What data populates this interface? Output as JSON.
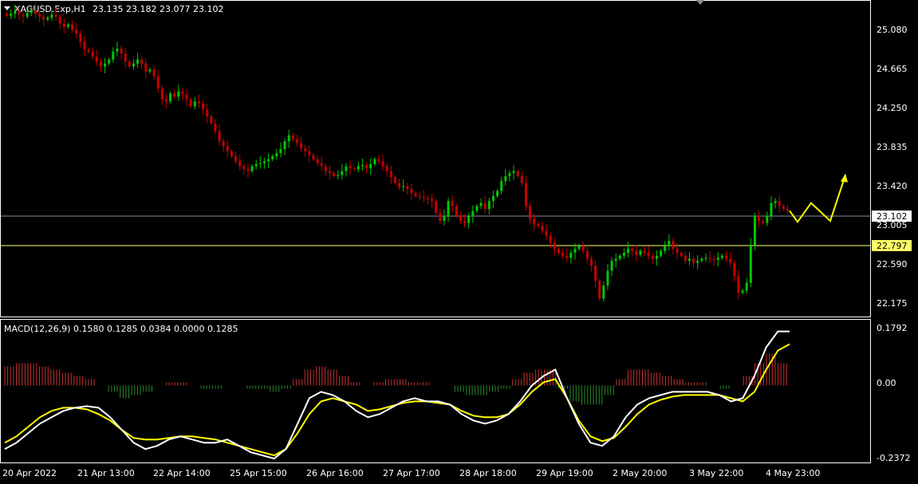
{
  "symbol_header": {
    "symbol": "XAGUSD.Exp,H1",
    "ohlc": "23.135 23.182 23.077 23.102"
  },
  "macd_header": {
    "label": "MACD(12,26,9) 0.1580 0.1285 0.0384 0.0000 0.1285"
  },
  "price_axis": {
    "ticks": [
      "25.080",
      "24.665",
      "24.250",
      "23.835",
      "23.420",
      "23.005",
      "22.590",
      "22.175"
    ],
    "current_price": "23.102",
    "level_line": "22.797"
  },
  "macd_axis": {
    "ticks": [
      "0.1792",
      "0.00",
      "-0.2372"
    ]
  },
  "time_axis": {
    "labels": [
      "20 Apr 2022",
      "21 Apr 13:00",
      "22 Apr 14:00",
      "25 Apr 15:00",
      "26 Apr 16:00",
      "27 Apr 17:00",
      "28 Apr 18:00",
      "29 Apr 19:00",
      "2 May 20:00",
      "3 May 22:00",
      "4 May 23:00"
    ]
  },
  "colors": {
    "background": "#000000",
    "bull_candle": "#00c800",
    "bear_candle": "#c80000",
    "macd_line": "#ffffff",
    "signal_line": "#ffff00",
    "level_line": "#ffff66",
    "current_price_line": "#8a8a9a",
    "axis_text": "#ffffff"
  },
  "chart_data": {
    "type": "candlestick",
    "title": "XAGUSD.Exp,H1",
    "ylim": [
      22.08,
      25.17
    ],
    "macd_ylim": [
      -0.2372,
      0.1792
    ],
    "closes": [
      25.06,
      25.08,
      25.1,
      25.07,
      25.05,
      25.09,
      25.12,
      25.08,
      25.05,
      25.02,
      25.04,
      25.07,
      25.05,
      24.98,
      24.95,
      24.97,
      24.92,
      24.88,
      24.8,
      24.72,
      24.7,
      24.65,
      24.6,
      24.55,
      24.58,
      24.62,
      24.7,
      24.73,
      24.68,
      24.6,
      24.55,
      24.58,
      24.62,
      24.58,
      24.5,
      24.52,
      24.45,
      24.33,
      24.22,
      24.2,
      24.28,
      24.25,
      24.3,
      24.27,
      24.22,
      24.15,
      24.2,
      24.18,
      24.12,
      24.05,
      23.98,
      23.9,
      23.8,
      23.75,
      23.7,
      23.65,
      23.6,
      23.55,
      23.52,
      23.5,
      23.55,
      23.57,
      23.58,
      23.6,
      23.62,
      23.65,
      23.68,
      23.72,
      23.8,
      23.86,
      23.82,
      23.78,
      23.73,
      23.7,
      23.66,
      23.62,
      23.58,
      23.55,
      23.5,
      23.48,
      23.45,
      23.46,
      23.5,
      23.55,
      23.53,
      23.52,
      23.55,
      23.56,
      23.53,
      23.57,
      23.62,
      23.6,
      23.55,
      23.5,
      23.44,
      23.38,
      23.34,
      23.35,
      23.32,
      23.28,
      23.25,
      23.24,
      23.23,
      23.22,
      23.2,
      23.08,
      23.0,
      23.05,
      23.2,
      23.15,
      23.05,
      23.0,
      22.98,
      23.05,
      23.1,
      23.15,
      23.18,
      23.12,
      23.2,
      23.25,
      23.3,
      23.4,
      23.45,
      23.48,
      23.5,
      23.45,
      23.38,
      23.15,
      23.02,
      22.97,
      22.95,
      22.9,
      22.85,
      22.78,
      22.72,
      22.68,
      22.65,
      22.63,
      22.68,
      22.72,
      22.75,
      22.7,
      22.62,
      22.55,
      22.4,
      22.22,
      22.35,
      22.5,
      22.6,
      22.62,
      22.65,
      22.68,
      22.72,
      22.7,
      22.66,
      22.7,
      22.68,
      22.65,
      22.62,
      22.65,
      22.7,
      22.75,
      22.8,
      22.72,
      22.68,
      22.65,
      22.6,
      22.62,
      22.58,
      22.6,
      22.62,
      22.63,
      22.62,
      22.61,
      22.63,
      22.65,
      22.62,
      22.58,
      22.45,
      22.28,
      22.3,
      22.38,
      22.76,
      23.05,
      23.0,
      22.98,
      23.05,
      23.18,
      23.2,
      23.15,
      23.12,
      23.1
    ],
    "forecast_path": [
      23.102,
      22.99,
      23.18,
      23.0,
      23.46
    ],
    "macd": [
      -0.2,
      -0.18,
      -0.15,
      -0.12,
      -0.1,
      -0.08,
      -0.07,
      -0.065,
      -0.07,
      -0.1,
      -0.14,
      -0.18,
      -0.2,
      -0.19,
      -0.17,
      -0.16,
      -0.17,
      -0.18,
      -0.18,
      -0.17,
      -0.19,
      -0.21,
      -0.22,
      -0.23,
      -0.2,
      -0.12,
      -0.04,
      -0.02,
      -0.03,
      -0.05,
      -0.08,
      -0.1,
      -0.09,
      -0.07,
      -0.05,
      -0.04,
      -0.05,
      -0.05,
      -0.06,
      -0.09,
      -0.11,
      -0.12,
      -0.11,
      -0.09,
      -0.05,
      0.0,
      0.03,
      0.05,
      -0.04,
      -0.12,
      -0.18,
      -0.19,
      -0.16,
      -0.1,
      -0.06,
      -0.04,
      -0.03,
      -0.02,
      -0.02,
      -0.02,
      -0.02,
      -0.03,
      -0.05,
      -0.04,
      0.03,
      0.12,
      0.17,
      0.17
    ],
    "signal": [
      -0.18,
      -0.16,
      -0.13,
      -0.1,
      -0.08,
      -0.07,
      -0.07,
      -0.075,
      -0.09,
      -0.11,
      -0.14,
      -0.165,
      -0.17,
      -0.17,
      -0.165,
      -0.16,
      -0.16,
      -0.165,
      -0.17,
      -0.18,
      -0.19,
      -0.2,
      -0.21,
      -0.22,
      -0.2,
      -0.15,
      -0.09,
      -0.05,
      -0.04,
      -0.05,
      -0.06,
      -0.08,
      -0.075,
      -0.065,
      -0.055,
      -0.05,
      -0.05,
      -0.055,
      -0.06,
      -0.08,
      -0.095,
      -0.1,
      -0.1,
      -0.09,
      -0.06,
      -0.02,
      0.01,
      0.02,
      -0.04,
      -0.11,
      -0.16,
      -0.175,
      -0.165,
      -0.13,
      -0.09,
      -0.06,
      -0.045,
      -0.035,
      -0.03,
      -0.03,
      -0.03,
      -0.03,
      -0.04,
      -0.05,
      -0.02,
      0.05,
      0.11,
      0.13
    ],
    "histogram": [
      0.06,
      0.07,
      0.07,
      0.06,
      0.05,
      0.04,
      0.03,
      0.02,
      0.0,
      -0.02,
      -0.04,
      -0.03,
      -0.02,
      0.0,
      0.01,
      0.01,
      0.0,
      -0.01,
      -0.01,
      0.0,
      0.0,
      -0.01,
      -0.01,
      -0.02,
      -0.01,
      0.02,
      0.05,
      0.06,
      0.05,
      0.03,
      0.01,
      0.0,
      0.01,
      0.02,
      0.02,
      0.01,
      0.01,
      0.0,
      0.0,
      -0.02,
      -0.03,
      -0.03,
      -0.02,
      -0.01,
      0.02,
      0.04,
      0.05,
      0.05,
      -0.01,
      -0.05,
      -0.06,
      -0.06,
      -0.03,
      0.02,
      0.05,
      0.05,
      0.04,
      0.03,
      0.02,
      0.01,
      0.01,
      0.0,
      -0.01,
      0.0,
      0.03,
      0.07,
      0.1,
      0.07
    ]
  }
}
